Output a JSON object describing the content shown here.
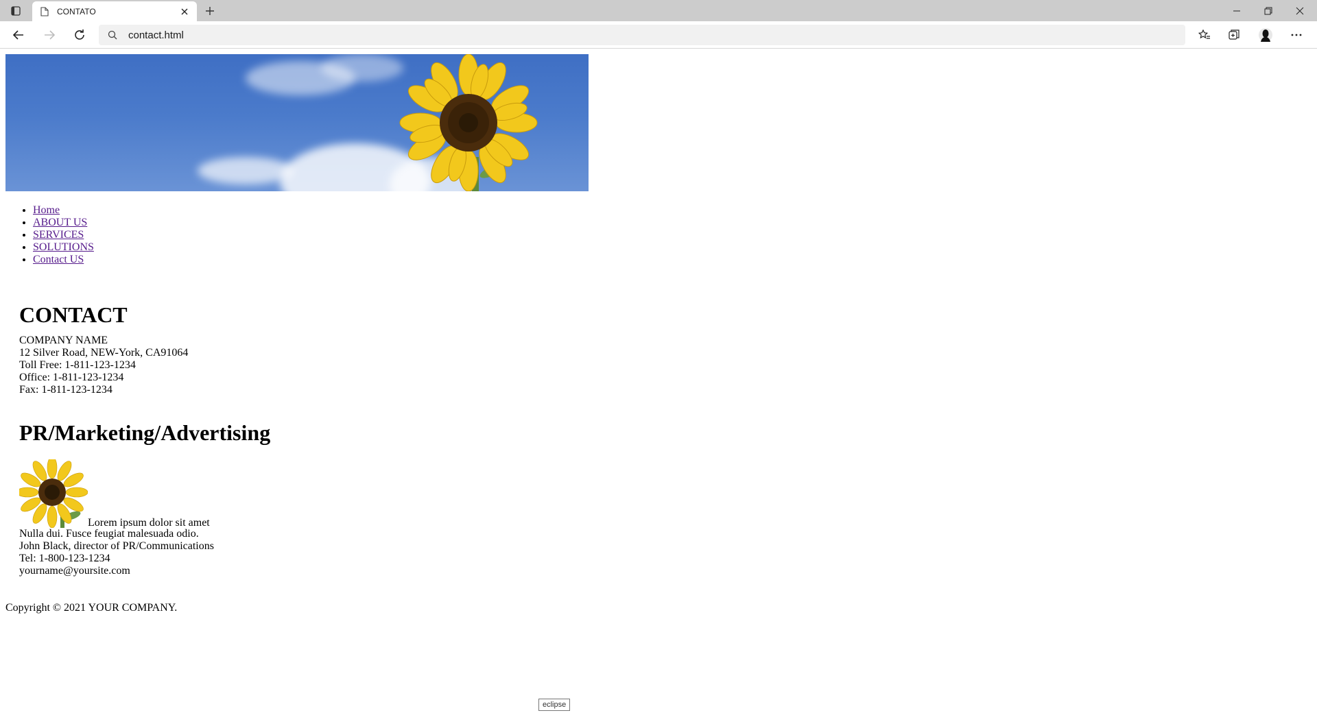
{
  "browser": {
    "tab_title": "CONTATO",
    "address": "contact.html"
  },
  "nav": {
    "items": [
      {
        "label": "Home"
      },
      {
        "label": "ABOUT US"
      },
      {
        "label": "SERVICES"
      },
      {
        "label": "SOLUTIONS"
      },
      {
        "label": "Contact US"
      }
    ]
  },
  "contact": {
    "heading": "CONTACT",
    "lines": [
      "COMPANY NAME",
      "12 Silver Road, NEW-York, CA91064",
      "Toll Free: 1-811-123-1234",
      "Office: 1-811-123-1234",
      "Fax: 1-811-123-1234"
    ]
  },
  "pr": {
    "heading": "PR/Marketing/Advertising",
    "first_line": "Lorem ipsum dolor sit amet",
    "lines": [
      "Nulla dui. Fusce feugiat malesuada odio.",
      "John Black, director of PR/Communications",
      "Tel: 1-800-123-1234",
      "yourname@yoursite.com"
    ]
  },
  "footer": {
    "copyright": "Copyright © 2021 YOUR COMPANY."
  },
  "tooltip": {
    "text": "eclipse"
  },
  "colors": {
    "tabbar": "#cccccc",
    "link_visited": "#551a8b",
    "sky": "#4b7bcb",
    "sunflower_petal": "#f2c81c",
    "sunflower_center": "#4a2c0c"
  },
  "icons": [
    "tab-actions-icon",
    "page-favicon-icon",
    "close-icon",
    "plus-icon",
    "minimize-icon",
    "restore-icon",
    "window-close-icon",
    "back-icon",
    "forward-icon",
    "refresh-icon",
    "search-icon",
    "favorites-icon",
    "collections-icon",
    "profile-icon",
    "more-icon"
  ]
}
